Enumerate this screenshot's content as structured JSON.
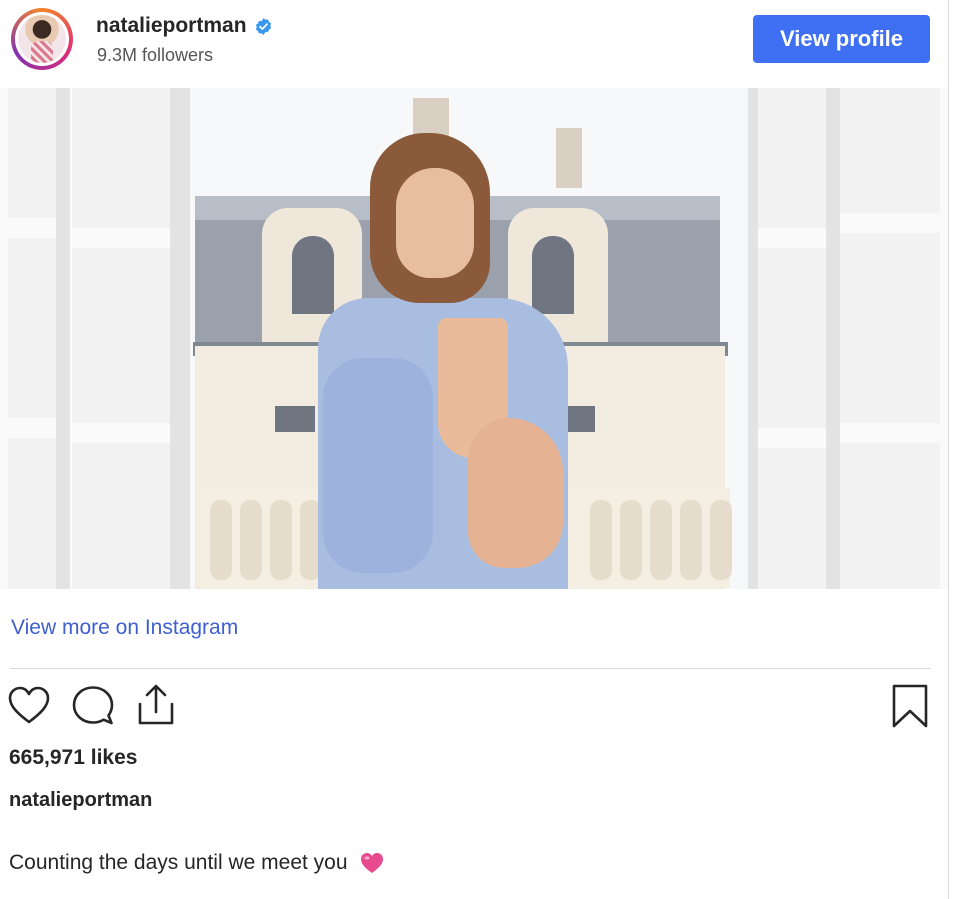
{
  "post": {
    "username": "natalieportman",
    "followers": "9.3M followers",
    "view_profile_label": "View profile",
    "verified_icon": "verified-badge-icon",
    "view_more_label": "View more on Instagram",
    "likes": "665,971 likes",
    "caption_user": "natalieportman",
    "caption_text": "Counting the days until we meet you",
    "caption_emoji": "pink-heart-emoji"
  },
  "actions": {
    "like_icon": "heart-icon",
    "comment_icon": "comment-icon",
    "share_icon": "share-icon",
    "save_icon": "bookmark-icon"
  },
  "colors": {
    "accent": "#3f6ff2",
    "link": "#3f5fd0",
    "verified": "#3897f0",
    "emoji": "#e84a8f"
  }
}
